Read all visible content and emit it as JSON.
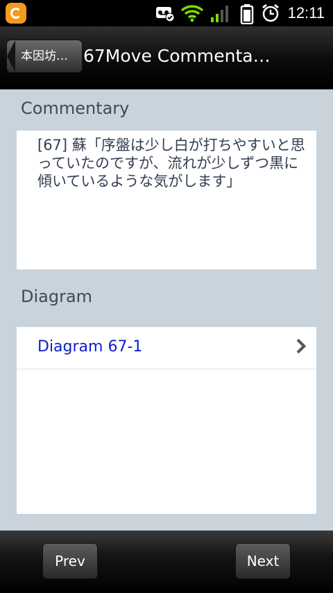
{
  "status_bar": {
    "time": "12:11",
    "icons": [
      "app-notification-icon",
      "voicemail-check-icon",
      "wifi-icon",
      "signal-icon",
      "battery-icon",
      "alarm-icon"
    ]
  },
  "title_bar": {
    "back_label": "本因坊…",
    "title": "67Move Commenta…"
  },
  "commentary": {
    "header": "Commentary",
    "text": "[67] 蘇「序盤は少し白が打ちやすいと思っていたのですが、流れが少しずつ黒に傾いているような気がします」"
  },
  "diagram": {
    "header": "Diagram",
    "items": [
      {
        "label": "Diagram 67-1"
      }
    ]
  },
  "footer": {
    "prev_label": "Prev",
    "next_label": "Next"
  },
  "colors": {
    "background": "#c9d3dc",
    "section_header": "#3e4a5a",
    "link": "#0b1fc8"
  }
}
